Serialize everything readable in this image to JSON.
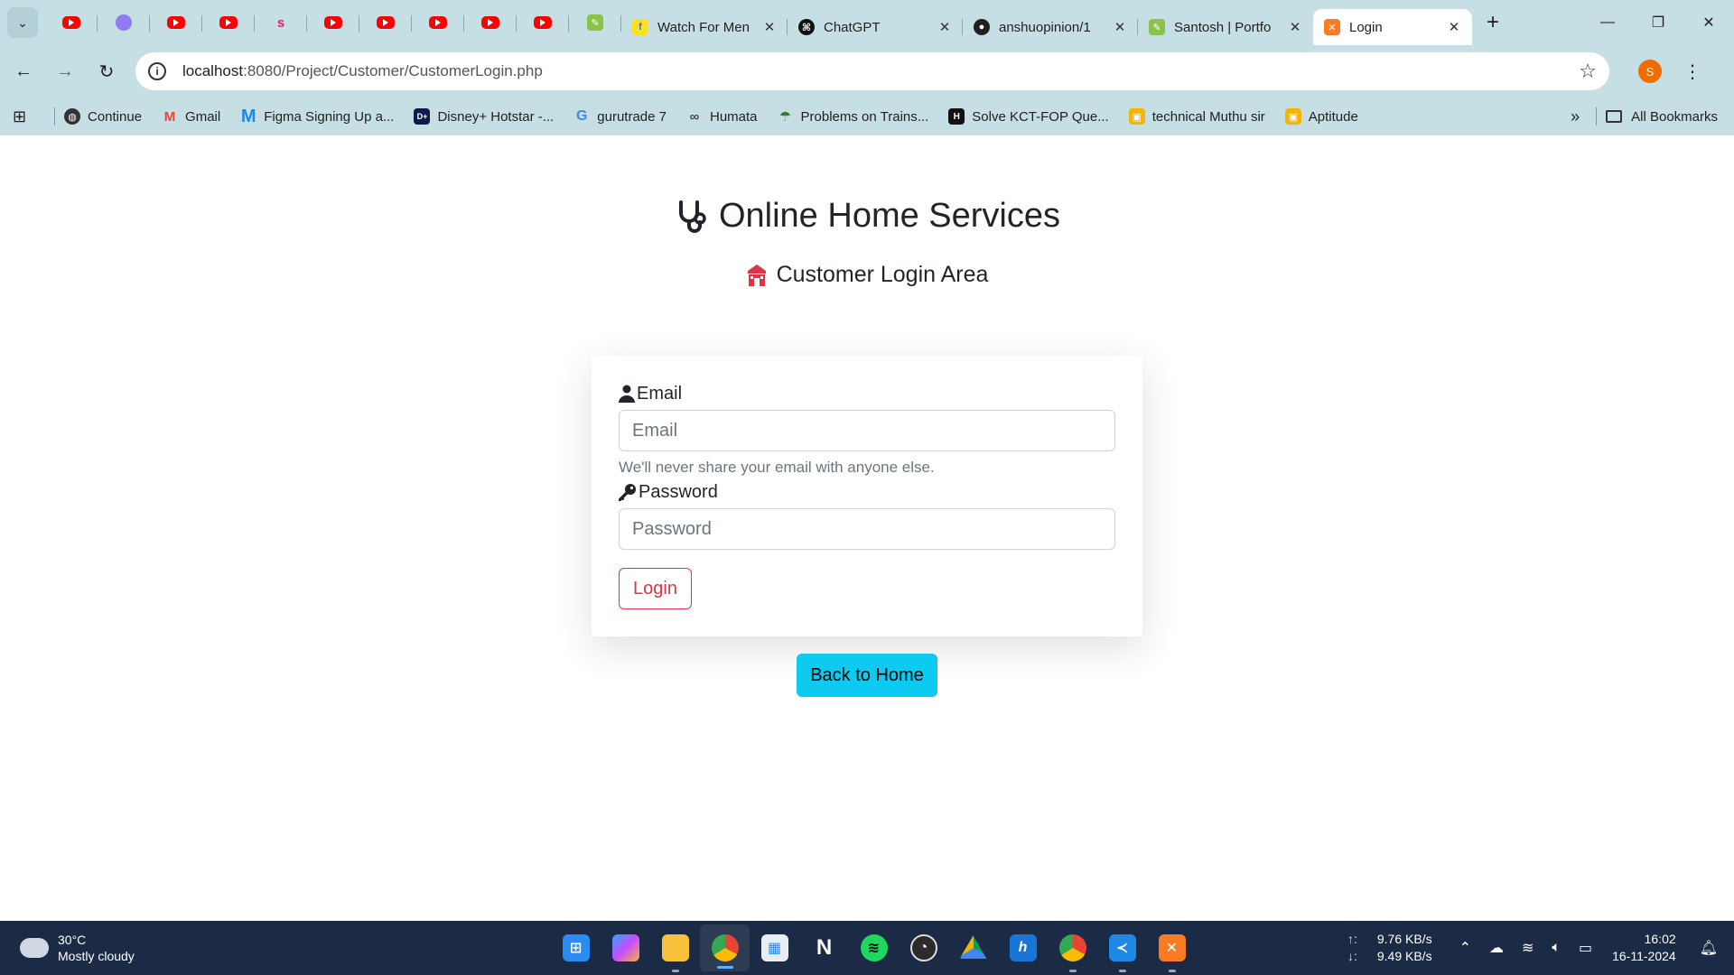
{
  "browser": {
    "tabs": [
      {
        "title": "Watch For Men",
        "favicon": "flipkart-icon",
        "width": 190
      },
      {
        "title": "ChatGPT",
        "favicon": "chatgpt-icon",
        "width": 190
      },
      {
        "title": "anshuopinion/1",
        "favicon": "github-icon",
        "width": 190
      },
      {
        "title": "Santosh | Portfo",
        "favicon": "portfolio-icon",
        "width": 190
      }
    ],
    "active_tab": {
      "title": "Login",
      "favicon": "xampp-icon"
    },
    "url_host": "localhost",
    "url_path": ":8080/Project/Customer/CustomerLogin.php",
    "profile_initial": "S"
  },
  "bookmarks": [
    {
      "label": "Continue",
      "icon": "globe-icon",
      "color": "#333333"
    },
    {
      "label": "Gmail",
      "icon": "gmail-icon",
      "color": "#ea4335"
    },
    {
      "label": "Figma Signing Up a...",
      "icon": "figma-icon",
      "color": "#1e88e5"
    },
    {
      "label": "Disney+ Hotstar -...",
      "icon": "hotstar-icon",
      "color": "#0c1a4b"
    },
    {
      "label": "gurutrade 7",
      "icon": "google-icon",
      "color": "#4285f4"
    },
    {
      "label": "Humata",
      "icon": "humata-icon",
      "color": "#444444"
    },
    {
      "label": "Problems on Trains...",
      "icon": "umbrella-icon",
      "color": "#2e7d32"
    },
    {
      "label": "Solve KCT-FOP Que...",
      "icon": "hackerrank-icon",
      "color": "#111111"
    },
    {
      "label": "technical Muthu sir",
      "icon": "classroom-icon",
      "color": "#f4b400"
    },
    {
      "label": "Aptitude",
      "icon": "classroom-icon",
      "color": "#f4b400"
    }
  ],
  "bookmarks_all": "All Bookmarks",
  "page": {
    "brand": "Online Home Services",
    "subtitle": "Customer Login Area",
    "email_label": "Email",
    "email_placeholder": "Email",
    "email_help": "We'll never share your email with anyone else.",
    "password_label": "Password",
    "password_placeholder": "Password",
    "login_label": "Login",
    "home_label": "Back to Home",
    "accent": "#dc3545",
    "info_color": "#0dcaf0"
  },
  "taskbar": {
    "temperature": "30°C",
    "condition": "Mostly cloudy",
    "upload": "9.76 KB/s",
    "download": "9.49 KB/s",
    "time": "16:02",
    "date": "16-11-2024"
  }
}
